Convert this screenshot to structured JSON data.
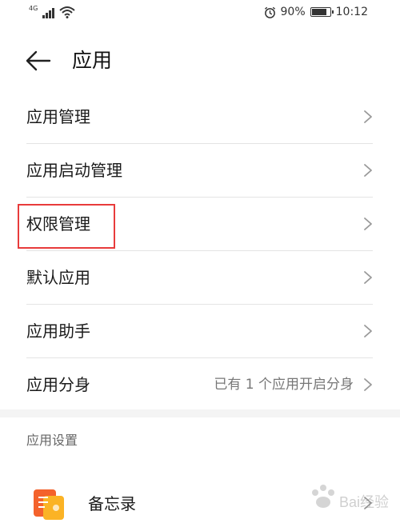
{
  "status_bar": {
    "network": "4G",
    "battery_percent_text": "90%",
    "battery_level": 0.9,
    "time": "10:12",
    "icons": [
      "signal-icon",
      "wifi-icon",
      "alarm-icon",
      "battery-icon"
    ]
  },
  "header": {
    "back_icon": "arrow-left-icon",
    "title": "应用"
  },
  "menu": [
    {
      "label": "应用管理",
      "value": ""
    },
    {
      "label": "应用启动管理",
      "value": ""
    },
    {
      "label": "权限管理",
      "value": ""
    },
    {
      "label": "默认应用",
      "value": ""
    },
    {
      "label": "应用助手",
      "value": ""
    },
    {
      "label": "应用分身",
      "value": "已有 1 个应用开启分身"
    }
  ],
  "highlight": {
    "target": "权限管理",
    "color": "#e83b3b"
  },
  "section": {
    "title": "应用设置"
  },
  "apps": [
    {
      "name": "备忘录",
      "icon": "notes-app-icon"
    }
  ],
  "watermark": {
    "text": "Bai经验"
  }
}
